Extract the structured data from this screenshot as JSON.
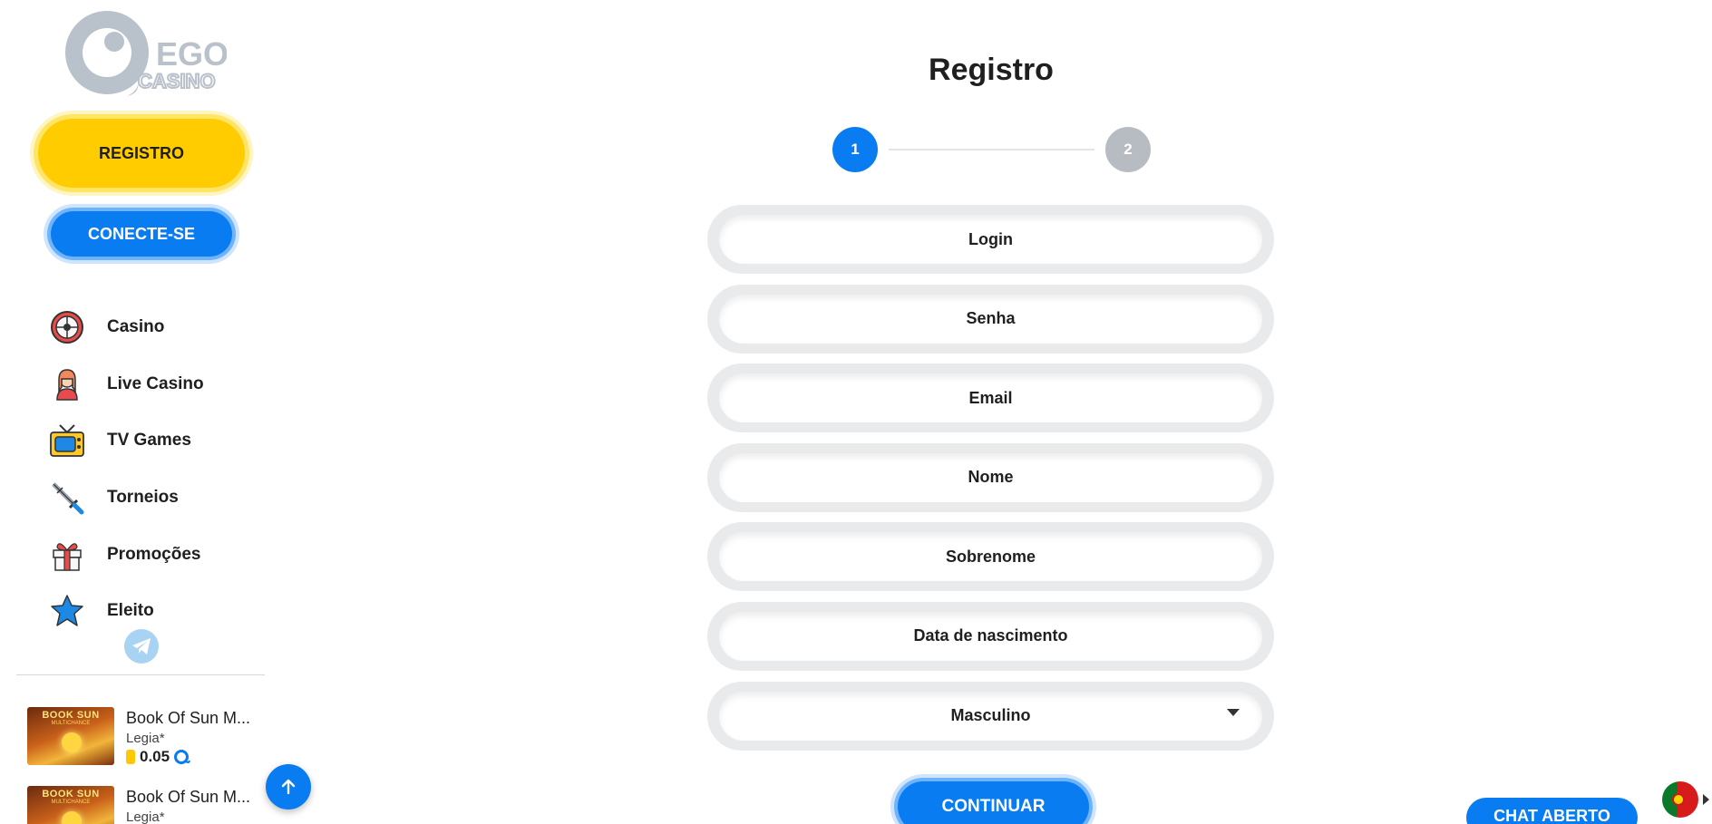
{
  "brand": {
    "logo_text_top": "EGO",
    "logo_text_bottom": "CASINO"
  },
  "sidebar": {
    "register_label": "REGISTRO",
    "login_label": "CONECTE-SE",
    "nav": [
      {
        "label": "Casino",
        "icon": "roulette-icon"
      },
      {
        "label": "Live Casino",
        "icon": "dealer-icon"
      },
      {
        "label": "TV Games",
        "icon": "tv-icon"
      },
      {
        "label": "Torneios",
        "icon": "swords-icon"
      },
      {
        "label": "Promoções",
        "icon": "gift-icon"
      },
      {
        "label": "Eleito",
        "icon": "star-icon"
      }
    ],
    "telegram_icon": "telegram-icon",
    "recent_wins": [
      {
        "game": "Book Of Sun M...",
        "user": "Legia*",
        "amount": "0.05",
        "thumb_line1": "BOOK SUN",
        "thumb_line2": "MULTICHANCE"
      },
      {
        "game": "Book Of Sun M...",
        "user": "Legia*",
        "amount": "",
        "thumb_line1": "BOOK SUN",
        "thumb_line2": "MULTICHANCE"
      }
    ]
  },
  "main": {
    "title": "Registro",
    "steps": [
      "1",
      "2"
    ],
    "active_step": 1,
    "fields": {
      "login_placeholder": "Login",
      "password_placeholder": "Senha",
      "email_placeholder": "Email",
      "first_name_placeholder": "Nome",
      "last_name_placeholder": "Sobrenome",
      "birthdate_placeholder": "Data de nascimento",
      "gender_value": "Masculino"
    },
    "continue_label": "CONTINUAR"
  },
  "chat": {
    "label": "CHAT ABERTO"
  },
  "colors": {
    "accent": "#0a7cf2",
    "register": "#ffcc00",
    "inactive_step": "#b7bcc2"
  }
}
